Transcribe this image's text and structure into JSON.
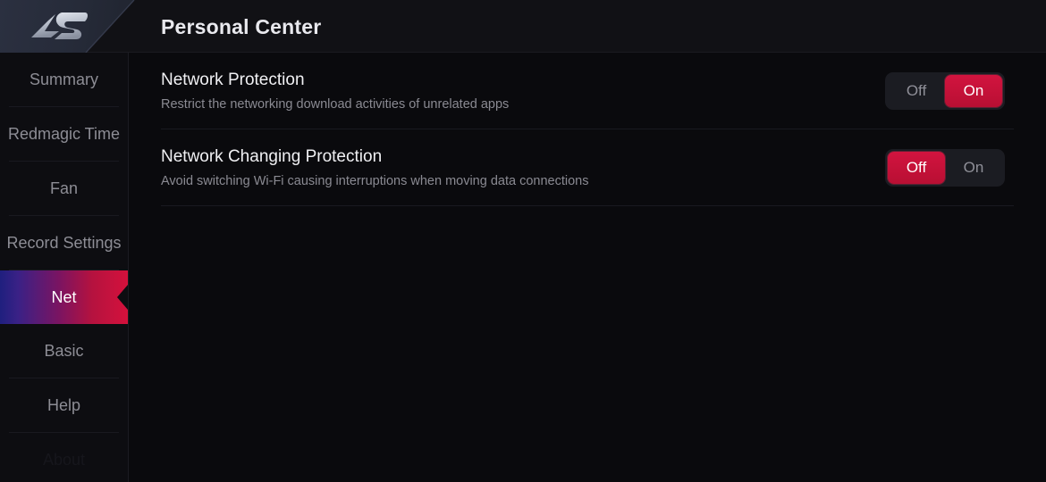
{
  "header": {
    "title": "Personal Center",
    "logo_icon": "redmagic-logo-icon"
  },
  "sidebar": {
    "items": [
      {
        "label": "Summary",
        "active": false
      },
      {
        "label": "Redmagic Time",
        "active": false
      },
      {
        "label": "Fan",
        "active": false
      },
      {
        "label": "Record Settings",
        "active": false
      },
      {
        "label": "Net",
        "active": true
      },
      {
        "label": "Basic",
        "active": false
      },
      {
        "label": "Help",
        "active": false
      },
      {
        "label": "About",
        "active": false
      }
    ]
  },
  "main": {
    "rows": [
      {
        "title": "Network Protection",
        "desc": "Restrict the networking download activities of unrelated apps",
        "toggle": {
          "off_label": "Off",
          "on_label": "On",
          "selected": "On"
        }
      },
      {
        "title": "Network Changing Protection",
        "desc": "Avoid switching Wi-Fi causing interruptions when moving data connections",
        "toggle": {
          "off_label": "Off",
          "on_label": "On",
          "selected": "Off"
        }
      }
    ]
  },
  "colors": {
    "accent_red": "#d2143f",
    "accent_blue": "#1f1f7e",
    "background": "#0a0a0d",
    "header_background": "#111115",
    "logo_plate": "#262b39"
  }
}
